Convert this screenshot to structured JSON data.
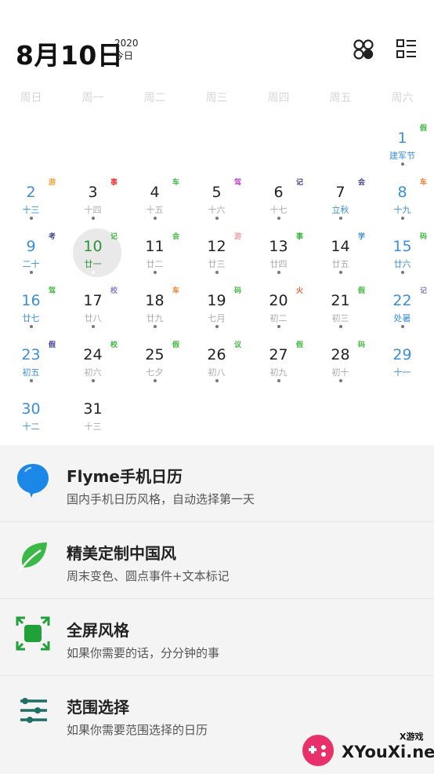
{
  "header": {
    "date": "8月10日",
    "year": "2020",
    "today_label": "今日",
    "icons": [
      "clover-apps-icon",
      "list-view-icon"
    ]
  },
  "weekdays": [
    "周日",
    "周一",
    "周二",
    "周三",
    "周四",
    "周五",
    "周六"
  ],
  "calendar": {
    "today": 10,
    "days": [
      {
        "day": "1",
        "lunar": "建军节",
        "tag": "假",
        "tag_color": "#3cb83c",
        "festival": true
      },
      {
        "day": "2",
        "lunar": "十三",
        "tag": "游",
        "tag_color": "#f0a030"
      },
      {
        "day": "3",
        "lunar": "十四",
        "tag": "事",
        "tag_color": "#e83a3a"
      },
      {
        "day": "4",
        "lunar": "十五",
        "tag": "车",
        "tag_color": "#3cb83c"
      },
      {
        "day": "5",
        "lunar": "十六",
        "tag": "驾",
        "tag_color": "#c040d0"
      },
      {
        "day": "6",
        "lunar": "十七",
        "tag": "记",
        "tag_color": "#404090"
      },
      {
        "day": "7",
        "lunar": "立秋",
        "tag": "会",
        "tag_color": "#404090",
        "festival": true
      },
      {
        "day": "8",
        "lunar": "十九",
        "tag": "车",
        "tag_color": "#f08030"
      },
      {
        "day": "9",
        "lunar": "二十",
        "tag": "考",
        "tag_color": "#404090"
      },
      {
        "day": "10",
        "lunar": "廿一",
        "tag": "记",
        "tag_color": "#3cb83c"
      },
      {
        "day": "11",
        "lunar": "廿二",
        "tag": "会",
        "tag_color": "#3cb83c"
      },
      {
        "day": "12",
        "lunar": "廿三",
        "tag": "游",
        "tag_color": "#f0a0a0"
      },
      {
        "day": "13",
        "lunar": "廿四",
        "tag": "事",
        "tag_color": "#3cb83c"
      },
      {
        "day": "14",
        "lunar": "廿五",
        "tag": "学",
        "tag_color": "#3a8fd8"
      },
      {
        "day": "15",
        "lunar": "廿六",
        "tag": "码",
        "tag_color": "#3cb83c"
      },
      {
        "day": "16",
        "lunar": "廿七",
        "tag": "驾",
        "tag_color": "#3cb83c"
      },
      {
        "day": "17",
        "lunar": "廿八",
        "tag": "校",
        "tag_color": "#8080d0"
      },
      {
        "day": "18",
        "lunar": "廿九",
        "tag": "车",
        "tag_color": "#f08030"
      },
      {
        "day": "19",
        "lunar": "七月",
        "tag": "码",
        "tag_color": "#3cb83c"
      },
      {
        "day": "20",
        "lunar": "初二",
        "tag": "火",
        "tag_color": "#f06030"
      },
      {
        "day": "21",
        "lunar": "初三",
        "tag": "假",
        "tag_color": "#3cb83c"
      },
      {
        "day": "22",
        "lunar": "处暑",
        "tag": "记",
        "tag_color": "#8080c0",
        "festival": true
      },
      {
        "day": "23",
        "lunar": "初五",
        "tag": "假",
        "tag_color": "#404090"
      },
      {
        "day": "24",
        "lunar": "初六",
        "tag": "校",
        "tag_color": "#3cb83c"
      },
      {
        "day": "25",
        "lunar": "七夕",
        "tag": "假",
        "tag_color": "#3cb83c"
      },
      {
        "day": "26",
        "lunar": "初八",
        "tag": "议",
        "tag_color": "#3cb83c"
      },
      {
        "day": "27",
        "lunar": "初九",
        "tag": "假",
        "tag_color": "#3cb83c"
      },
      {
        "day": "28",
        "lunar": "初十",
        "tag": "码",
        "tag_color": "#3cb83c"
      },
      {
        "day": "29",
        "lunar": "十一",
        "tag": "",
        "tag_color": ""
      },
      {
        "day": "30",
        "lunar": "十二",
        "tag": "",
        "tag_color": ""
      },
      {
        "day": "31",
        "lunar": "十三",
        "tag": "",
        "tag_color": ""
      }
    ]
  },
  "features": [
    {
      "icon": "blue-balloon-icon",
      "title": "Flyme手机日历",
      "desc": "国内手机日历风格，自动选择第一天"
    },
    {
      "icon": "green-leaf-icon",
      "title": "精美定制中国风",
      "desc": "周末变色、圆点事件+文本标记"
    },
    {
      "icon": "fullscreen-icon",
      "title": "全屏风格",
      "desc": "如果你需要的话，分分钟的事"
    },
    {
      "icon": "range-select-icon",
      "title": "范围选择",
      "desc": "如果你需要范围选择的日历"
    }
  ],
  "watermark": {
    "badge": "X游戏",
    "site": "XYouXi.net"
  },
  "colors": {
    "weekend": "#3a8fd8",
    "today": "#2f8f3e",
    "today_bg": "#e9e9e9",
    "panel_bg": "#f4f4f4"
  }
}
